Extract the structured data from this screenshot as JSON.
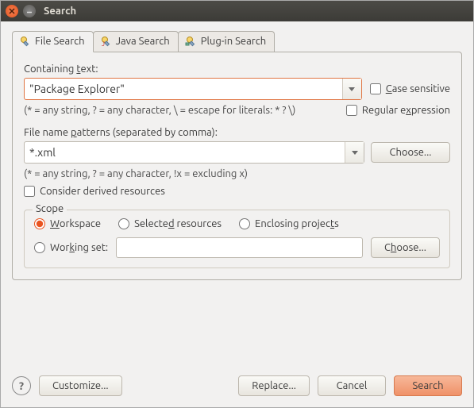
{
  "window": {
    "title": "Search"
  },
  "tabs": {
    "file": "File Search",
    "java": "Java Search",
    "plugin": "Plug-in Search"
  },
  "containing": {
    "label_pre": "Containing ",
    "label_u": "t",
    "label_post": "ext:",
    "value": "\"Package Explorer\"",
    "hint": "(* = any string, ? = any character, \\ = escape for literals: * ? \\)"
  },
  "case": {
    "pre": "",
    "u": "C",
    "post": "ase sensitive"
  },
  "regex": {
    "pre": "Regular e",
    "u": "x",
    "post": "pression"
  },
  "filenames": {
    "label_pre": "File name ",
    "label_u": "p",
    "label_post": "atterns (separated by comma):",
    "value": "*.xml",
    "hint": "(* = any string, ? = any character, !x = excluding x)",
    "choose": "Choose..."
  },
  "derived": {
    "label": "Consider derived resources"
  },
  "scope": {
    "title": "Scope",
    "workspace": {
      "pre": "",
      "u": "W",
      "post": "orkspace"
    },
    "selected": {
      "pre": "Selecte",
      "u": "d",
      "post": " resources"
    },
    "enclosing": {
      "pre": "Enclosing projec",
      "u": "t",
      "post": "s"
    },
    "workingset": {
      "pre": "Wor",
      "u": "k",
      "post": "ing set:"
    },
    "choose": {
      "pre": "C",
      "u": "h",
      "post": "oose..."
    },
    "ws_value": ""
  },
  "footer": {
    "customize": "Customize...",
    "replace": "Replace...",
    "cancel": "Cancel",
    "search": "Search"
  }
}
